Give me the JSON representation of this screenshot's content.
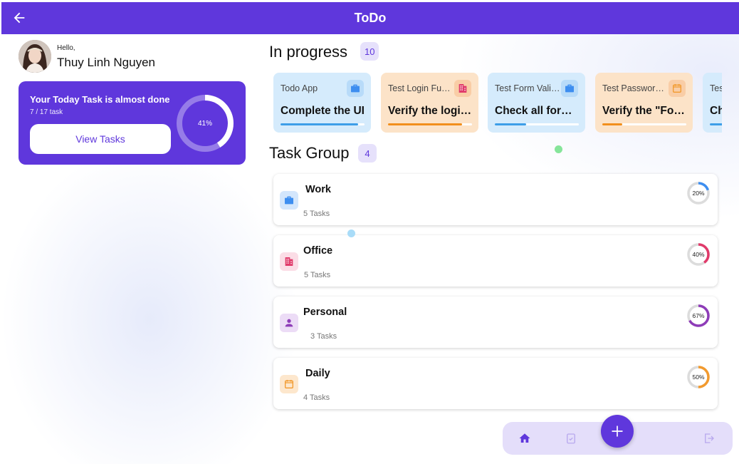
{
  "app": {
    "title": "ToDo"
  },
  "profile": {
    "greeting": "Hello,",
    "name": "Thuy Linh Nguyen"
  },
  "today": {
    "heading": "Your Today Task is almost done",
    "count": "7 / 17 task",
    "button_label": "View Tasks",
    "percent_label": "41%",
    "progress": 0.41
  },
  "in_progress": {
    "title": "In progress",
    "count": "10",
    "cards": [
      {
        "title": "Todo App",
        "desc": "Complete the UI",
        "icon": "briefcase-icon",
        "theme": "blue",
        "progress": 0.92
      },
      {
        "title": "Test Login Function",
        "desc": "Verify the login flow",
        "icon": "building-icon",
        "theme": "orange",
        "progress": 0.88
      },
      {
        "title": "Test Form Validation",
        "desc": "Check all form fields",
        "icon": "briefcase-icon",
        "theme": "blue",
        "progress": 0.37
      },
      {
        "title": "Test Password Reset",
        "desc": "Verify the \"Forgot password\"",
        "icon": "calendar-icon",
        "theme": "orange",
        "progress": 0.24
      },
      {
        "title": "Test",
        "desc": "Check",
        "icon": "briefcase-icon",
        "theme": "blue",
        "progress": 0.5
      }
    ]
  },
  "task_group": {
    "title": "Task Group",
    "count": "4",
    "groups": [
      {
        "name": "Work",
        "count": "5 Tasks",
        "percent_label": "20%",
        "progress": 0.2,
        "color": "#3d8ef0",
        "icon": "briefcase-icon",
        "icon_bg": "#d3e6fc"
      },
      {
        "name": "Office",
        "count": "5 Tasks",
        "percent_label": "40%",
        "progress": 0.4,
        "color": "#e03a6a",
        "icon": "building-icon",
        "icon_bg": "#fbdde6"
      },
      {
        "name": "Personal",
        "count": "3 Tasks",
        "percent_label": "67%",
        "progress": 0.67,
        "color": "#8e3cb8",
        "icon": "person-icon",
        "icon_bg": "#ecdcf6"
      },
      {
        "name": "Daily",
        "count": "4 Tasks",
        "percent_label": "50%",
        "progress": 0.5,
        "color": "#f29a2e",
        "icon": "calendar-icon",
        "icon_bg": "#fde7cd"
      }
    ]
  },
  "nav": {
    "home": "home-icon",
    "tasks": "clipboard-check-icon",
    "add": "plus-icon",
    "logout": "logout-icon"
  },
  "colors": {
    "primary": "#5f37dc",
    "badge_bg": "#e6e1fb",
    "nav_bg": "#e4defa"
  }
}
